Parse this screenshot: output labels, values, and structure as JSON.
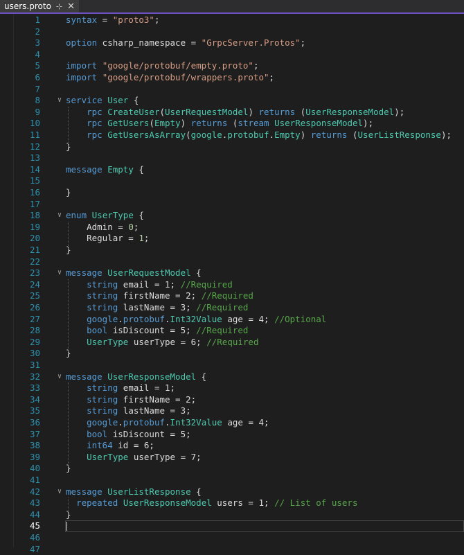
{
  "tab": {
    "filename": "users.proto",
    "pin_glyph": "⊹",
    "close_glyph": "✕"
  },
  "current_line": 45,
  "lines": [
    {
      "n": "1",
      "fold": "",
      "tokens": [
        [
          "k",
          "syntax"
        ],
        [
          "p",
          " = "
        ],
        [
          "s",
          "\"proto3\""
        ],
        [
          "p",
          ";"
        ]
      ]
    },
    {
      "n": "2",
      "fold": "",
      "tokens": []
    },
    {
      "n": "3",
      "fold": "",
      "tokens": [
        [
          "k",
          "option"
        ],
        [
          "p",
          " csharp_namespace = "
        ],
        [
          "s",
          "\"GrpcServer.Protos\""
        ],
        [
          "p",
          ";"
        ]
      ]
    },
    {
      "n": "4",
      "fold": "",
      "tokens": []
    },
    {
      "n": "5",
      "fold": "",
      "tokens": [
        [
          "k",
          "import"
        ],
        [
          "p",
          " "
        ],
        [
          "s",
          "\"google/protobuf/empty.proto\""
        ],
        [
          "p",
          ";"
        ]
      ]
    },
    {
      "n": "6",
      "fold": "",
      "tokens": [
        [
          "k",
          "import"
        ],
        [
          "p",
          " "
        ],
        [
          "s",
          "\"google/protobuf/wrappers.proto\""
        ],
        [
          "p",
          ";"
        ]
      ]
    },
    {
      "n": "7",
      "fold": "",
      "tokens": []
    },
    {
      "n": "8",
      "fold": "v",
      "tokens": [
        [
          "k",
          "service"
        ],
        [
          "p",
          " "
        ],
        [
          "t",
          "User"
        ],
        [
          "p",
          " {"
        ]
      ]
    },
    {
      "n": "9",
      "fold": "",
      "tokens": [
        [
          "p",
          "    "
        ],
        [
          "k",
          "rpc"
        ],
        [
          "p",
          " "
        ],
        [
          "t",
          "CreateUser"
        ],
        [
          "p",
          "("
        ],
        [
          "t",
          "UserRequestModel"
        ],
        [
          "p",
          ") "
        ],
        [
          "k",
          "returns"
        ],
        [
          "p",
          " ("
        ],
        [
          "t",
          "UserResponseModel"
        ],
        [
          "p",
          ");"
        ]
      ]
    },
    {
      "n": "10",
      "fold": "",
      "tokens": [
        [
          "p",
          "    "
        ],
        [
          "k",
          "rpc"
        ],
        [
          "p",
          " "
        ],
        [
          "t",
          "GetUsers"
        ],
        [
          "p",
          "("
        ],
        [
          "t",
          "Empty"
        ],
        [
          "p",
          ") "
        ],
        [
          "k",
          "returns"
        ],
        [
          "p",
          " ("
        ],
        [
          "k",
          "stream"
        ],
        [
          "p",
          " "
        ],
        [
          "t",
          "UserResponseModel"
        ],
        [
          "p",
          ");"
        ]
      ]
    },
    {
      "n": "11",
      "fold": "",
      "tokens": [
        [
          "p",
          "    "
        ],
        [
          "k",
          "rpc"
        ],
        [
          "p",
          " "
        ],
        [
          "t",
          "GetUsersAsArray"
        ],
        [
          "p",
          "("
        ],
        [
          "t",
          "google"
        ],
        [
          "p",
          "."
        ],
        [
          "t",
          "protobuf"
        ],
        [
          "p",
          "."
        ],
        [
          "t",
          "Empty"
        ],
        [
          "p",
          ") "
        ],
        [
          "k",
          "returns"
        ],
        [
          "p",
          " ("
        ],
        [
          "t",
          "UserListResponse"
        ],
        [
          "p",
          ");"
        ]
      ]
    },
    {
      "n": "12",
      "fold": "",
      "tokens": [
        [
          "p",
          "}"
        ]
      ]
    },
    {
      "n": "13",
      "fold": "",
      "tokens": []
    },
    {
      "n": "14",
      "fold": "",
      "tokens": [
        [
          "k",
          "message"
        ],
        [
          "p",
          " "
        ],
        [
          "t",
          "Empty"
        ],
        [
          "p",
          " {"
        ]
      ]
    },
    {
      "n": "15",
      "fold": "",
      "tokens": []
    },
    {
      "n": "16",
      "fold": "",
      "tokens": [
        [
          "p",
          "}"
        ]
      ]
    },
    {
      "n": "17",
      "fold": "",
      "tokens": []
    },
    {
      "n": "18",
      "fold": "v",
      "tokens": [
        [
          "k",
          "enum"
        ],
        [
          "p",
          " "
        ],
        [
          "t",
          "UserType"
        ],
        [
          "p",
          " {"
        ]
      ]
    },
    {
      "n": "19",
      "fold": "",
      "tokens": [
        [
          "p",
          "    Admin = "
        ],
        [
          "n",
          "0"
        ],
        [
          "p",
          ";"
        ]
      ]
    },
    {
      "n": "20",
      "fold": "",
      "tokens": [
        [
          "p",
          "    Regular = "
        ],
        [
          "n",
          "1"
        ],
        [
          "p",
          ";"
        ]
      ]
    },
    {
      "n": "21",
      "fold": "",
      "tokens": [
        [
          "p",
          "}"
        ]
      ]
    },
    {
      "n": "22",
      "fold": "",
      "tokens": []
    },
    {
      "n": "23",
      "fold": "v",
      "tokens": [
        [
          "k",
          "message"
        ],
        [
          "p",
          " "
        ],
        [
          "t",
          "UserRequestModel"
        ],
        [
          "p",
          " {"
        ]
      ]
    },
    {
      "n": "24",
      "fold": "",
      "tokens": [
        [
          "p",
          "    "
        ],
        [
          "k",
          "string"
        ],
        [
          "p",
          " email = 1; "
        ],
        [
          "c",
          "//Required"
        ]
      ]
    },
    {
      "n": "25",
      "fold": "",
      "tokens": [
        [
          "p",
          "    "
        ],
        [
          "k",
          "string"
        ],
        [
          "p",
          " firstName = 2; "
        ],
        [
          "c",
          "//Required"
        ]
      ]
    },
    {
      "n": "26",
      "fold": "",
      "tokens": [
        [
          "p",
          "    "
        ],
        [
          "k",
          "string"
        ],
        [
          "p",
          " lastName = 3; "
        ],
        [
          "c",
          "//Required"
        ]
      ]
    },
    {
      "n": "27",
      "fold": "",
      "tokens": [
        [
          "p",
          "    "
        ],
        [
          "k",
          "google"
        ],
        [
          "p",
          "."
        ],
        [
          "k",
          "protobuf"
        ],
        [
          "p",
          "."
        ],
        [
          "t",
          "Int32Value"
        ],
        [
          "p",
          " age = 4; "
        ],
        [
          "c",
          "//Optional"
        ]
      ]
    },
    {
      "n": "28",
      "fold": "",
      "tokens": [
        [
          "p",
          "    "
        ],
        [
          "k",
          "bool"
        ],
        [
          "p",
          " isDiscount = 5; "
        ],
        [
          "c",
          "//Required"
        ]
      ]
    },
    {
      "n": "29",
      "fold": "",
      "tokens": [
        [
          "p",
          "    "
        ],
        [
          "t",
          "UserType"
        ],
        [
          "p",
          " userType = 6; "
        ],
        [
          "c",
          "//Required"
        ]
      ]
    },
    {
      "n": "30",
      "fold": "",
      "tokens": [
        [
          "p",
          "}"
        ]
      ]
    },
    {
      "n": "31",
      "fold": "",
      "tokens": []
    },
    {
      "n": "32",
      "fold": "v",
      "tokens": [
        [
          "k",
          "message"
        ],
        [
          "p",
          " "
        ],
        [
          "t",
          "UserResponseModel"
        ],
        [
          "p",
          " {"
        ]
      ]
    },
    {
      "n": "33",
      "fold": "",
      "tokens": [
        [
          "p",
          "    "
        ],
        [
          "k",
          "string"
        ],
        [
          "p",
          " email = 1;"
        ]
      ]
    },
    {
      "n": "34",
      "fold": "",
      "tokens": [
        [
          "p",
          "    "
        ],
        [
          "k",
          "string"
        ],
        [
          "p",
          " firstName = 2;"
        ]
      ]
    },
    {
      "n": "35",
      "fold": "",
      "tokens": [
        [
          "p",
          "    "
        ],
        [
          "k",
          "string"
        ],
        [
          "p",
          " lastName = 3;"
        ]
      ]
    },
    {
      "n": "36",
      "fold": "",
      "tokens": [
        [
          "p",
          "    "
        ],
        [
          "k",
          "google"
        ],
        [
          "p",
          "."
        ],
        [
          "k",
          "protobuf"
        ],
        [
          "p",
          "."
        ],
        [
          "t",
          "Int32Value"
        ],
        [
          "p",
          " age = 4;"
        ]
      ]
    },
    {
      "n": "37",
      "fold": "",
      "tokens": [
        [
          "p",
          "    "
        ],
        [
          "k",
          "bool"
        ],
        [
          "p",
          " isDiscount = 5;"
        ]
      ]
    },
    {
      "n": "38",
      "fold": "",
      "tokens": [
        [
          "p",
          "    "
        ],
        [
          "k",
          "int64"
        ],
        [
          "p",
          " id = 6;"
        ]
      ]
    },
    {
      "n": "39",
      "fold": "",
      "tokens": [
        [
          "p",
          "    "
        ],
        [
          "t",
          "UserType"
        ],
        [
          "p",
          " userType = 7;"
        ]
      ]
    },
    {
      "n": "40",
      "fold": "",
      "tokens": [
        [
          "p",
          "}"
        ]
      ]
    },
    {
      "n": "41",
      "fold": "",
      "tokens": []
    },
    {
      "n": "42",
      "fold": "v",
      "tokens": [
        [
          "k",
          "message"
        ],
        [
          "p",
          " "
        ],
        [
          "t",
          "UserListResponse"
        ],
        [
          "p",
          " {"
        ]
      ]
    },
    {
      "n": "43",
      "fold": "",
      "tokens": [
        [
          "p",
          "  "
        ],
        [
          "k",
          "repeated"
        ],
        [
          "p",
          " "
        ],
        [
          "t",
          "UserResponseModel"
        ],
        [
          "p",
          " users = 1; "
        ],
        [
          "c",
          "// List of users"
        ]
      ]
    },
    {
      "n": "44",
      "fold": "",
      "tokens": [
        [
          "p",
          "}"
        ]
      ]
    },
    {
      "n": "45",
      "fold": "",
      "tokens": []
    },
    {
      "n": "46",
      "fold": "",
      "tokens": []
    },
    {
      "n": "47",
      "fold": "",
      "tokens": []
    }
  ],
  "colors": {
    "background": "#1e1e1e",
    "keyword": "#569cd6",
    "type": "#4ec9b0",
    "string": "#d69d85",
    "comment": "#57a64a",
    "number": "#b5cea8",
    "line_number": "#2b91af",
    "tab_accent": "#6f4fc6"
  }
}
